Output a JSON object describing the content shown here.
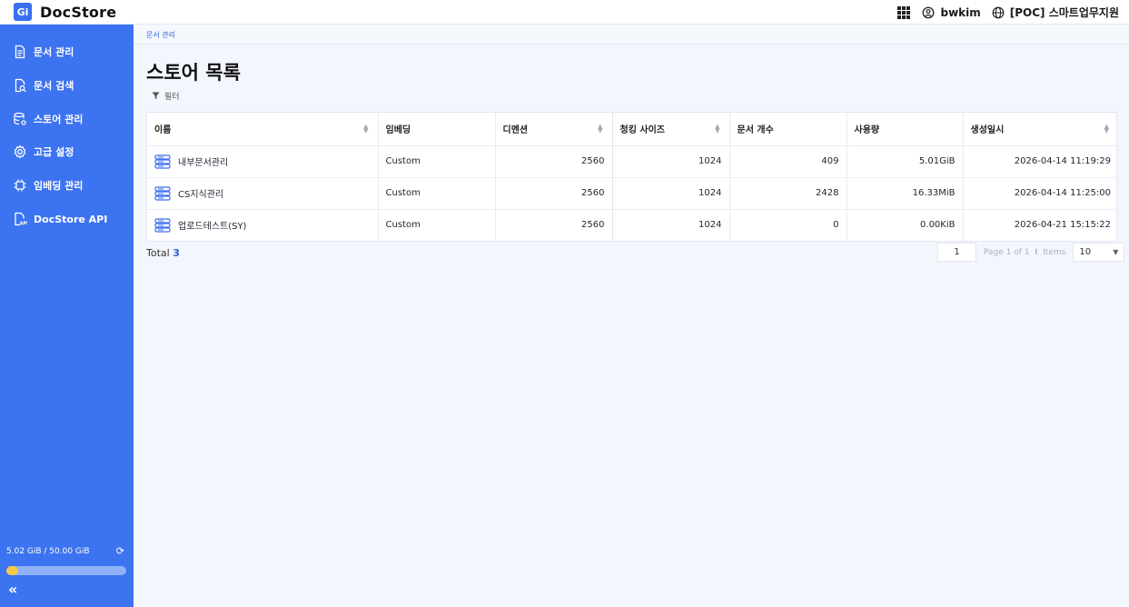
{
  "app": {
    "logo_text": "Gi",
    "name": "DocStore"
  },
  "header": {
    "user": "bwkim",
    "org": "[POC] 스마트업무지원"
  },
  "sidebar": {
    "items": [
      {
        "label": "문서 관리",
        "icon": "document-icon"
      },
      {
        "label": "문서 검색",
        "icon": "document-search-icon"
      },
      {
        "label": "스토어 관리",
        "icon": "database-settings-icon"
      },
      {
        "label": "고급 설정",
        "icon": "gear-icon"
      },
      {
        "label": "임베딩 관리",
        "icon": "chip-icon"
      },
      {
        "label": "DocStore API",
        "icon": "api-file-icon"
      }
    ],
    "storage": {
      "text": "5.02 GiB / 50.00 GiB",
      "used_fraction": 0.1004
    }
  },
  "breadcrumb": "문서 관리",
  "page": {
    "title": "스토어 목록",
    "filter_label": "필터"
  },
  "table": {
    "columns": [
      "이름",
      "임베딩",
      "디멘션",
      "청킹 사이즈",
      "문서 개수",
      "사용량",
      "생성일시"
    ],
    "rows": [
      {
        "name": "내부문서관리",
        "embedding": "Custom",
        "dimension": "2560",
        "chunk": "1024",
        "docs": "409",
        "usage": "5.01GiB",
        "created": "2026-04-14 11:19:29"
      },
      {
        "name": "CS지식관리",
        "embedding": "Custom",
        "dimension": "2560",
        "chunk": "1024",
        "docs": "2428",
        "usage": "16.33MiB",
        "created": "2026-04-14 11:25:00"
      },
      {
        "name": "업로드테스트(SY)",
        "embedding": "Custom",
        "dimension": "2560",
        "chunk": "1024",
        "docs": "0",
        "usage": "0.00KiB",
        "created": "2026-04-21 15:15:22"
      }
    ]
  },
  "footer": {
    "total_label": "Total",
    "total_count": "3",
    "page_value": "1",
    "page_info": "Page 1 of 1",
    "separator": "I",
    "items_label": "Items",
    "items_per_page": "10"
  }
}
